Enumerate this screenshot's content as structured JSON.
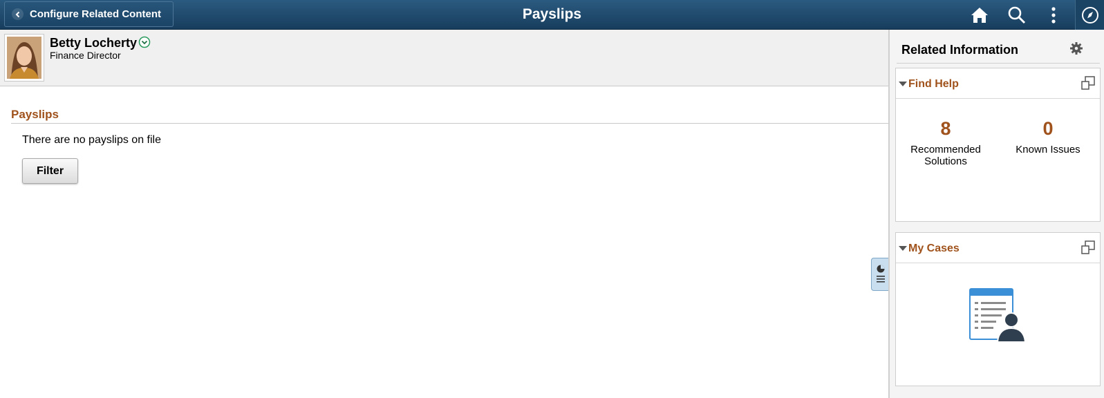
{
  "header": {
    "back_label": "Configure Related Content",
    "title": "Payslips",
    "icons": [
      "home-icon",
      "search-icon",
      "more-vertical-icon",
      "navbar-compass-icon"
    ]
  },
  "person": {
    "name": "Betty Locherty",
    "job_title": "Finance Director"
  },
  "main": {
    "section_title": "Payslips",
    "empty_message": "There are no payslips on file",
    "filter_label": "Filter"
  },
  "related": {
    "title": "Related Information",
    "tiles": [
      {
        "title": "Find Help",
        "metrics": [
          {
            "value": "8",
            "label": "Recommended Solutions"
          },
          {
            "value": "0",
            "label": "Known Issues"
          }
        ]
      },
      {
        "title": "My Cases"
      }
    ]
  },
  "colors": {
    "header_bg": "#1f4a6e",
    "accent": "#a0521c",
    "panel_bg": "#f4f4f4"
  }
}
